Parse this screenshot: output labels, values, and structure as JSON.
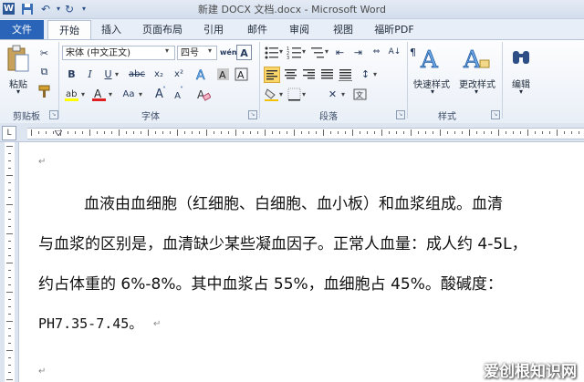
{
  "window": {
    "title": "新建 DOCX 文档.docx - Microsoft Word",
    "app_icon_letter": "W"
  },
  "tabs": {
    "file": "文件",
    "items": [
      "开始",
      "插入",
      "页面布局",
      "引用",
      "邮件",
      "审阅",
      "视图",
      "福昕PDF"
    ],
    "active": "开始"
  },
  "ribbon": {
    "clipboard": {
      "label": "剪贴板",
      "paste": "粘贴"
    },
    "font": {
      "label": "字体",
      "font_name": "宋体 (中文正文)",
      "font_size": "四号",
      "bold": "B",
      "italic": "I",
      "underline": "U",
      "strike": "abc",
      "subscript": "x₂",
      "superscript": "x²",
      "grow": "A",
      "shrink": "A",
      "case": "Aa",
      "clear_format": "A"
    },
    "paragraph": {
      "label": "段落"
    },
    "styles": {
      "label": "样式",
      "quick_styles": "快速样式",
      "change_styles": "更改样式"
    },
    "editing": {
      "label": "编辑"
    }
  },
  "document": {
    "lines": [
      "血液由血细胞（红细胞、白细胞、血小板）和血浆组成。血清",
      "与血浆的区别是，血清缺少某些凝血因子。正常人血量：成人约 4-5L，",
      "约占体重的 6%-8%。其中血浆占 55%，血细胞占 45%。酸碱度：",
      "PH7.35-7.45。"
    ],
    "paragraph_mark": "↵"
  },
  "watermark": "爱创根知识网",
  "colors": {
    "file_tab": "#2a64b8",
    "accent": "#2b5797"
  }
}
